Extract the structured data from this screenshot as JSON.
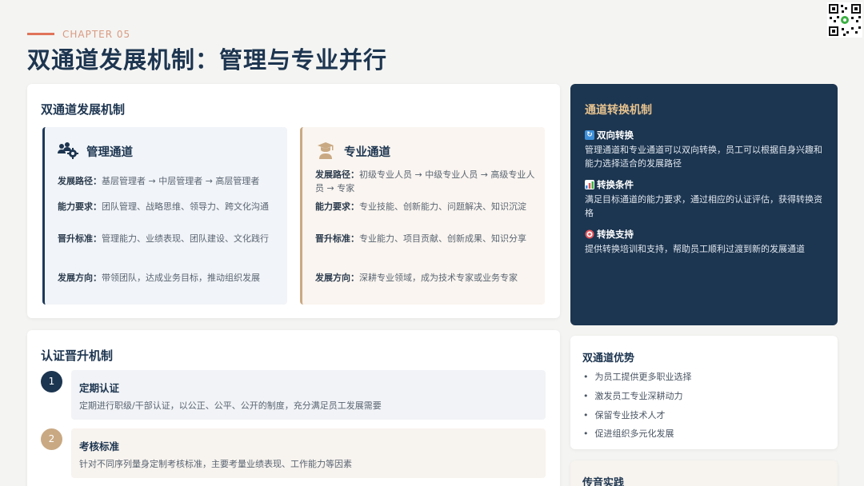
{
  "header": {
    "chapter": "CHAPTER 05",
    "title": "双通道发展机制：管理与专业并行"
  },
  "dual_channel": {
    "title": "双通道发展机制",
    "management": {
      "title": "管理通道",
      "icon": "users-gear-icon",
      "rows": [
        {
          "label": "发展路径：",
          "text": "基层管理者 → 中层管理者 → 高层管理者"
        },
        {
          "label": "能力要求：",
          "text": "团队管理、战略思维、领导力、跨文化沟通"
        },
        {
          "label": "晋升标准：",
          "text": "管理能力、业绩表现、团队建设、文化践行"
        },
        {
          "label": "发展方向：",
          "text": "带领团队，达成业务目标，推动组织发展"
        }
      ]
    },
    "professional": {
      "title": "专业通道",
      "icon": "graduate-icon",
      "rows": [
        {
          "label": "发展路径：",
          "text": "初级专业人员 → 中级专业人员 → 高级专业人员 → 专家"
        },
        {
          "label": "能力要求：",
          "text": "专业技能、创新能力、问题解决、知识沉淀"
        },
        {
          "label": "晋升标准：",
          "text": "专业能力、项目贡献、创新成果、知识分享"
        },
        {
          "label": "发展方向：",
          "text": "深耕专业领域，成为技术专家或业务专家"
        }
      ]
    }
  },
  "certification": {
    "title": "认证晋升机制",
    "steps": [
      {
        "num": "1",
        "title": "定期认证",
        "desc": "定期进行职级/干部认证，以公正、公平、公开的制度，充分满足员工发展需要"
      },
      {
        "num": "2",
        "title": "考核标准",
        "desc": "针对不同序列量身定制考核标准，主要考量业绩表现、工作能力等因素"
      }
    ]
  },
  "conversion": {
    "title": "通道转换机制",
    "items": [
      {
        "icon": "cycle-arrows-icon",
        "head": "双向转换",
        "text": "管理通道和专业通道可以双向转换，员工可以根据自身兴趣和能力选择适合的发展路径"
      },
      {
        "icon": "bar-chart-icon",
        "head": "转换条件",
        "text": "满足目标通道的能力要求，通过相应的认证评估，获得转换资格"
      },
      {
        "icon": "target-icon",
        "head": "转换支持",
        "text": "提供转换培训和支持，帮助员工顺利过渡到新的发展通道"
      }
    ]
  },
  "advantages": {
    "title": "双通道优势",
    "items": [
      "为员工提供更多职业选择",
      "激发员工专业深耕动力",
      "保留专业技术人才",
      "促进组织多元化发展"
    ]
  },
  "practice": {
    "title": "传音实践"
  },
  "colors": {
    "navy": "#1c3550",
    "gold": "#e6c28e",
    "accent": "#e0735a",
    "tan": "#c9a983"
  }
}
